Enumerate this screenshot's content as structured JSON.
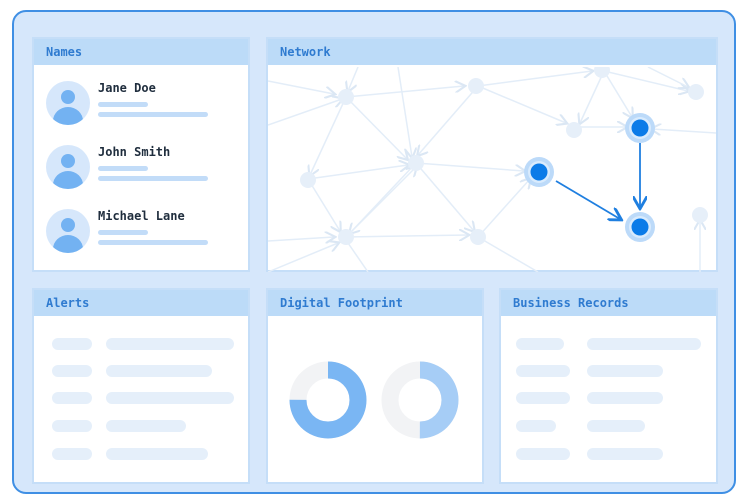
{
  "panels": {
    "names": "Names",
    "network": "Network",
    "alerts": "Alerts",
    "digital_footprint": "Digital Footprint",
    "business_records": "Business Records"
  },
  "contacts": [
    {
      "name": "Jane Doe",
      "icon": "user-avatar-icon"
    },
    {
      "name": "John Smith",
      "icon": "user-avatar-icon"
    },
    {
      "name": "Michael Lane",
      "icon": "user-avatar-icon"
    }
  ],
  "footprint": {
    "donut_left_fraction": 0.75,
    "donut_right_fraction": 0.5
  },
  "colors": {
    "accent": "#3f8fe4",
    "node_active": "#0b7be8",
    "node_idle": "#e6eff9",
    "header_bg": "#bcdbf8",
    "header_text": "#2f7bd0",
    "frame_bg": "#d6e7fb"
  }
}
